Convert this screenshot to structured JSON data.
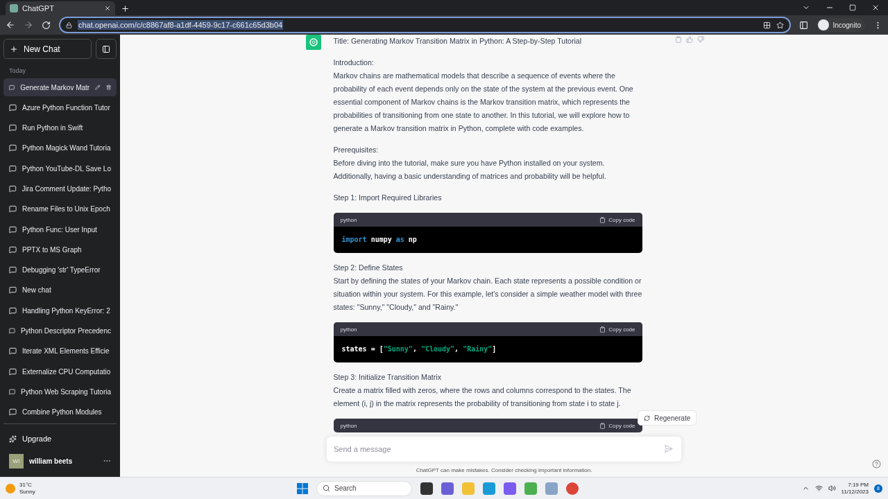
{
  "browser": {
    "tab_title": "ChatGPT",
    "url": "chat.openai.com/c/c8867af8-a1df-4459-9c17-c661c65d3b04",
    "profile": "Incognito"
  },
  "sidebar": {
    "new_chat": "New Chat",
    "section": "Today",
    "items": [
      {
        "label": "Generate Markov Matr",
        "selected": true
      },
      {
        "label": "Azure Python Function Tutor",
        "selected": false
      },
      {
        "label": "Run Python in Swift",
        "selected": false
      },
      {
        "label": "Python Magick Wand Tutoria",
        "selected": false
      },
      {
        "label": "Python YouTube-DL Save Lo",
        "selected": false
      },
      {
        "label": "Jira Comment Update: Pytho",
        "selected": false
      },
      {
        "label": "Rename Files to Unix Epoch",
        "selected": false
      },
      {
        "label": "Python Func: User Input",
        "selected": false
      },
      {
        "label": "PPTX to MS Graph",
        "selected": false
      },
      {
        "label": "Debugging 'str' TypeError",
        "selected": false
      },
      {
        "label": "New chat",
        "selected": false
      },
      {
        "label": "Handling Python KeyError: 2",
        "selected": false
      },
      {
        "label": "Python Descriptor Precedenc",
        "selected": false
      },
      {
        "label": "Iterate XML Elements Efficie",
        "selected": false
      },
      {
        "label": "Externalize CPU Computatio",
        "selected": false
      },
      {
        "label": "Python Web Scraping Tutoria",
        "selected": false
      },
      {
        "label": "Combine Python Modules",
        "selected": false
      }
    ],
    "upgrade": "Upgrade",
    "user": {
      "initials": "WI",
      "name": "william beets"
    }
  },
  "message": {
    "blocks": [
      {
        "kind": "paragraph",
        "text": "Title: Generating Markov Transition Matrix in Python: A Step-by-Step Tutorial"
      },
      {
        "kind": "heading",
        "text": "Introduction:"
      },
      {
        "kind": "paragraph",
        "text": "Markov chains are mathematical models that describe a sequence of events where the probability of each event depends only on the state of the system at the previous event. One essential component of Markov chains is the Markov transition matrix, which represents the probabilities of transitioning from one state to another. In this tutorial, we will explore how to generate a Markov transition matrix in Python, complete with code examples."
      },
      {
        "kind": "heading",
        "text": "Prerequisites:"
      },
      {
        "kind": "paragraph",
        "text": "Before diving into the tutorial, make sure you have Python installed on your system. Additionally, having a basic understanding of matrices and probability will be helpful."
      },
      {
        "kind": "heading",
        "text": "Step 1: Import Required Libraries"
      },
      {
        "kind": "code",
        "language": "python",
        "copy": "Copy code",
        "tokens": [
          {
            "color": "#2e95d3",
            "text": "import"
          },
          {
            "text": " numpy "
          },
          {
            "color": "#2e95d3",
            "text": "as"
          },
          {
            "text": " np"
          }
        ]
      },
      {
        "kind": "heading",
        "text": "Step 2: Define States"
      },
      {
        "kind": "paragraph",
        "text": "Start by defining the states of your Markov chain. Each state represents a possible condition or situation within your system. For this example, let's consider a simple weather model with three states: \"Sunny,\" \"Cloudy,\" and \"Rainy.\""
      },
      {
        "kind": "code",
        "language": "python",
        "copy": "Copy code",
        "tokens": [
          {
            "text": "states = ["
          },
          {
            "color": "#00a67d",
            "text": "\"Sunny\""
          },
          {
            "text": ", "
          },
          {
            "color": "#00a67d",
            "text": "\"Cloudy\""
          },
          {
            "text": ", "
          },
          {
            "color": "#00a67d",
            "text": "\"Rainy\""
          },
          {
            "text": "]"
          }
        ]
      },
      {
        "kind": "heading",
        "text": "Step 3: Initialize Transition Matrix"
      },
      {
        "kind": "paragraph",
        "text": "Create a matrix filled with zeros, where the rows and columns correspond to the states. The element (i, j) in the matrix represents the probability of transitioning from state i to state j."
      },
      {
        "kind": "code",
        "language": "python",
        "copy": "Copy code"
      }
    ],
    "regenerate": "Regenerate"
  },
  "composer": {
    "placeholder": "Send a message",
    "disclaimer": "ChatGPT can make mistakes. Consider checking important information."
  },
  "taskbar": {
    "temperature": "31°C",
    "weather": "Sunny",
    "search": "Search",
    "time": "7:19 PM",
    "date": "11/12/2023",
    "notifications": "8"
  }
}
